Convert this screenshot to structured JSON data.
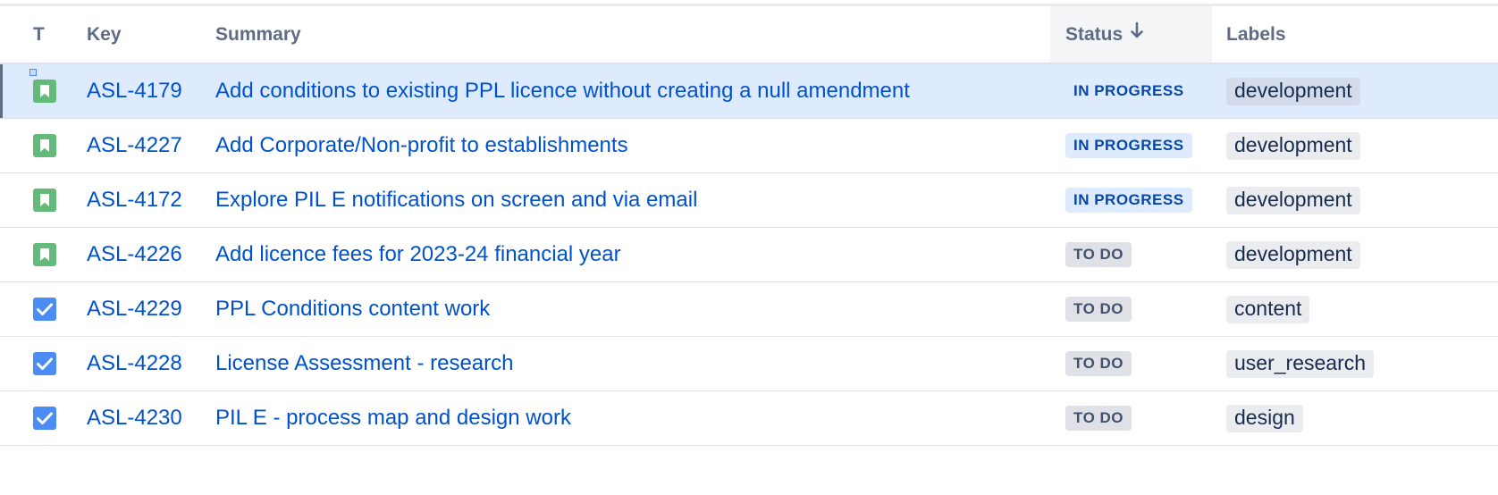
{
  "columns": {
    "type": "T",
    "key": "Key",
    "summary": "Summary",
    "status": "Status",
    "labels": "Labels"
  },
  "sort": {
    "column": "Status",
    "direction": "descending",
    "icon": "arrow-down-icon"
  },
  "colors": {
    "link": "#0052cc",
    "story_icon": "#63ba7b",
    "task_icon": "#4c8cf5",
    "selected_row": "#deebff",
    "in_progress_text": "#0747a6",
    "in_progress_bg": "#deebff",
    "todo_text": "#42526e",
    "todo_bg": "#dfe1e6"
  },
  "rows": [
    {
      "type": "story",
      "key": "ASL-4179",
      "summary": "Add conditions to existing PPL licence without creating a null amendment",
      "status": "IN PROGRESS",
      "label": "development",
      "selected": true
    },
    {
      "type": "story",
      "key": "ASL-4227",
      "summary": "Add Corporate/Non-profit to establishments",
      "status": "IN PROGRESS",
      "label": "development"
    },
    {
      "type": "story",
      "key": "ASL-4172",
      "summary": "Explore PIL E notifications on screen and via email",
      "status": "IN PROGRESS",
      "label": "development"
    },
    {
      "type": "story",
      "key": "ASL-4226",
      "summary": "Add licence fees for 2023-24 financial year",
      "status": "TO DO",
      "label": "development"
    },
    {
      "type": "task",
      "key": "ASL-4229",
      "summary": "PPL Conditions content work",
      "status": "TO DO",
      "label": "content"
    },
    {
      "type": "task",
      "key": "ASL-4228",
      "summary": "License Assessment - research",
      "status": "TO DO",
      "label": "user_research"
    },
    {
      "type": "task",
      "key": "ASL-4230",
      "summary": "PIL E - process map and design work",
      "status": "TO DO",
      "label": "design"
    }
  ]
}
